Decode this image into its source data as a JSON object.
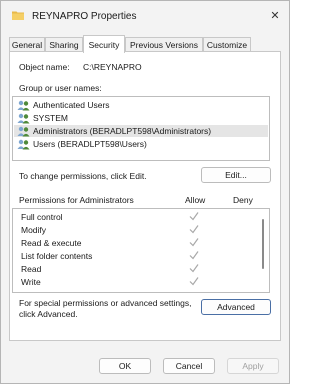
{
  "window": {
    "title": "REYNAPRO Properties",
    "close_glyph": "✕"
  },
  "tabs": [
    {
      "label": "General"
    },
    {
      "label": "Sharing"
    },
    {
      "label": "Security",
      "active": true
    },
    {
      "label": "Previous Versions"
    },
    {
      "label": "Customize"
    }
  ],
  "security": {
    "object_name_label": "Object name:",
    "object_name_value": "C:\\REYNAPRO",
    "group_label": "Group or user names:",
    "principals": [
      {
        "name": "Authenticated Users",
        "selected": false
      },
      {
        "name": "SYSTEM",
        "selected": false
      },
      {
        "name": "Administrators (BERADLPT598\\Administrators)",
        "selected": true
      },
      {
        "name": "Users (BERADLPT598\\Users)",
        "selected": false
      }
    ],
    "change_hint": "To change permissions, click Edit.",
    "edit_label": "Edit...",
    "permissions_for": "Permissions for Administrators",
    "allow_header": "Allow",
    "deny_header": "Deny",
    "permissions": [
      {
        "name": "Full control",
        "allow": true,
        "deny": false
      },
      {
        "name": "Modify",
        "allow": true,
        "deny": false
      },
      {
        "name": "Read & execute",
        "allow": true,
        "deny": false
      },
      {
        "name": "List folder contents",
        "allow": true,
        "deny": false
      },
      {
        "name": "Read",
        "allow": true,
        "deny": false
      },
      {
        "name": "Write",
        "allow": true,
        "deny": false
      }
    ],
    "special_hint_line1": "For special permissions or advanced settings,",
    "special_hint_line2": "click Advanced.",
    "advanced_label": "Advanced"
  },
  "footer": {
    "ok_label": "OK",
    "cancel_label": "Cancel",
    "apply_label": "Apply",
    "apply_enabled": false
  },
  "colors": {
    "accent": "#4a6fa5",
    "check_disabled": "#a8a8a8",
    "folder_icon": "#e8b94a"
  }
}
